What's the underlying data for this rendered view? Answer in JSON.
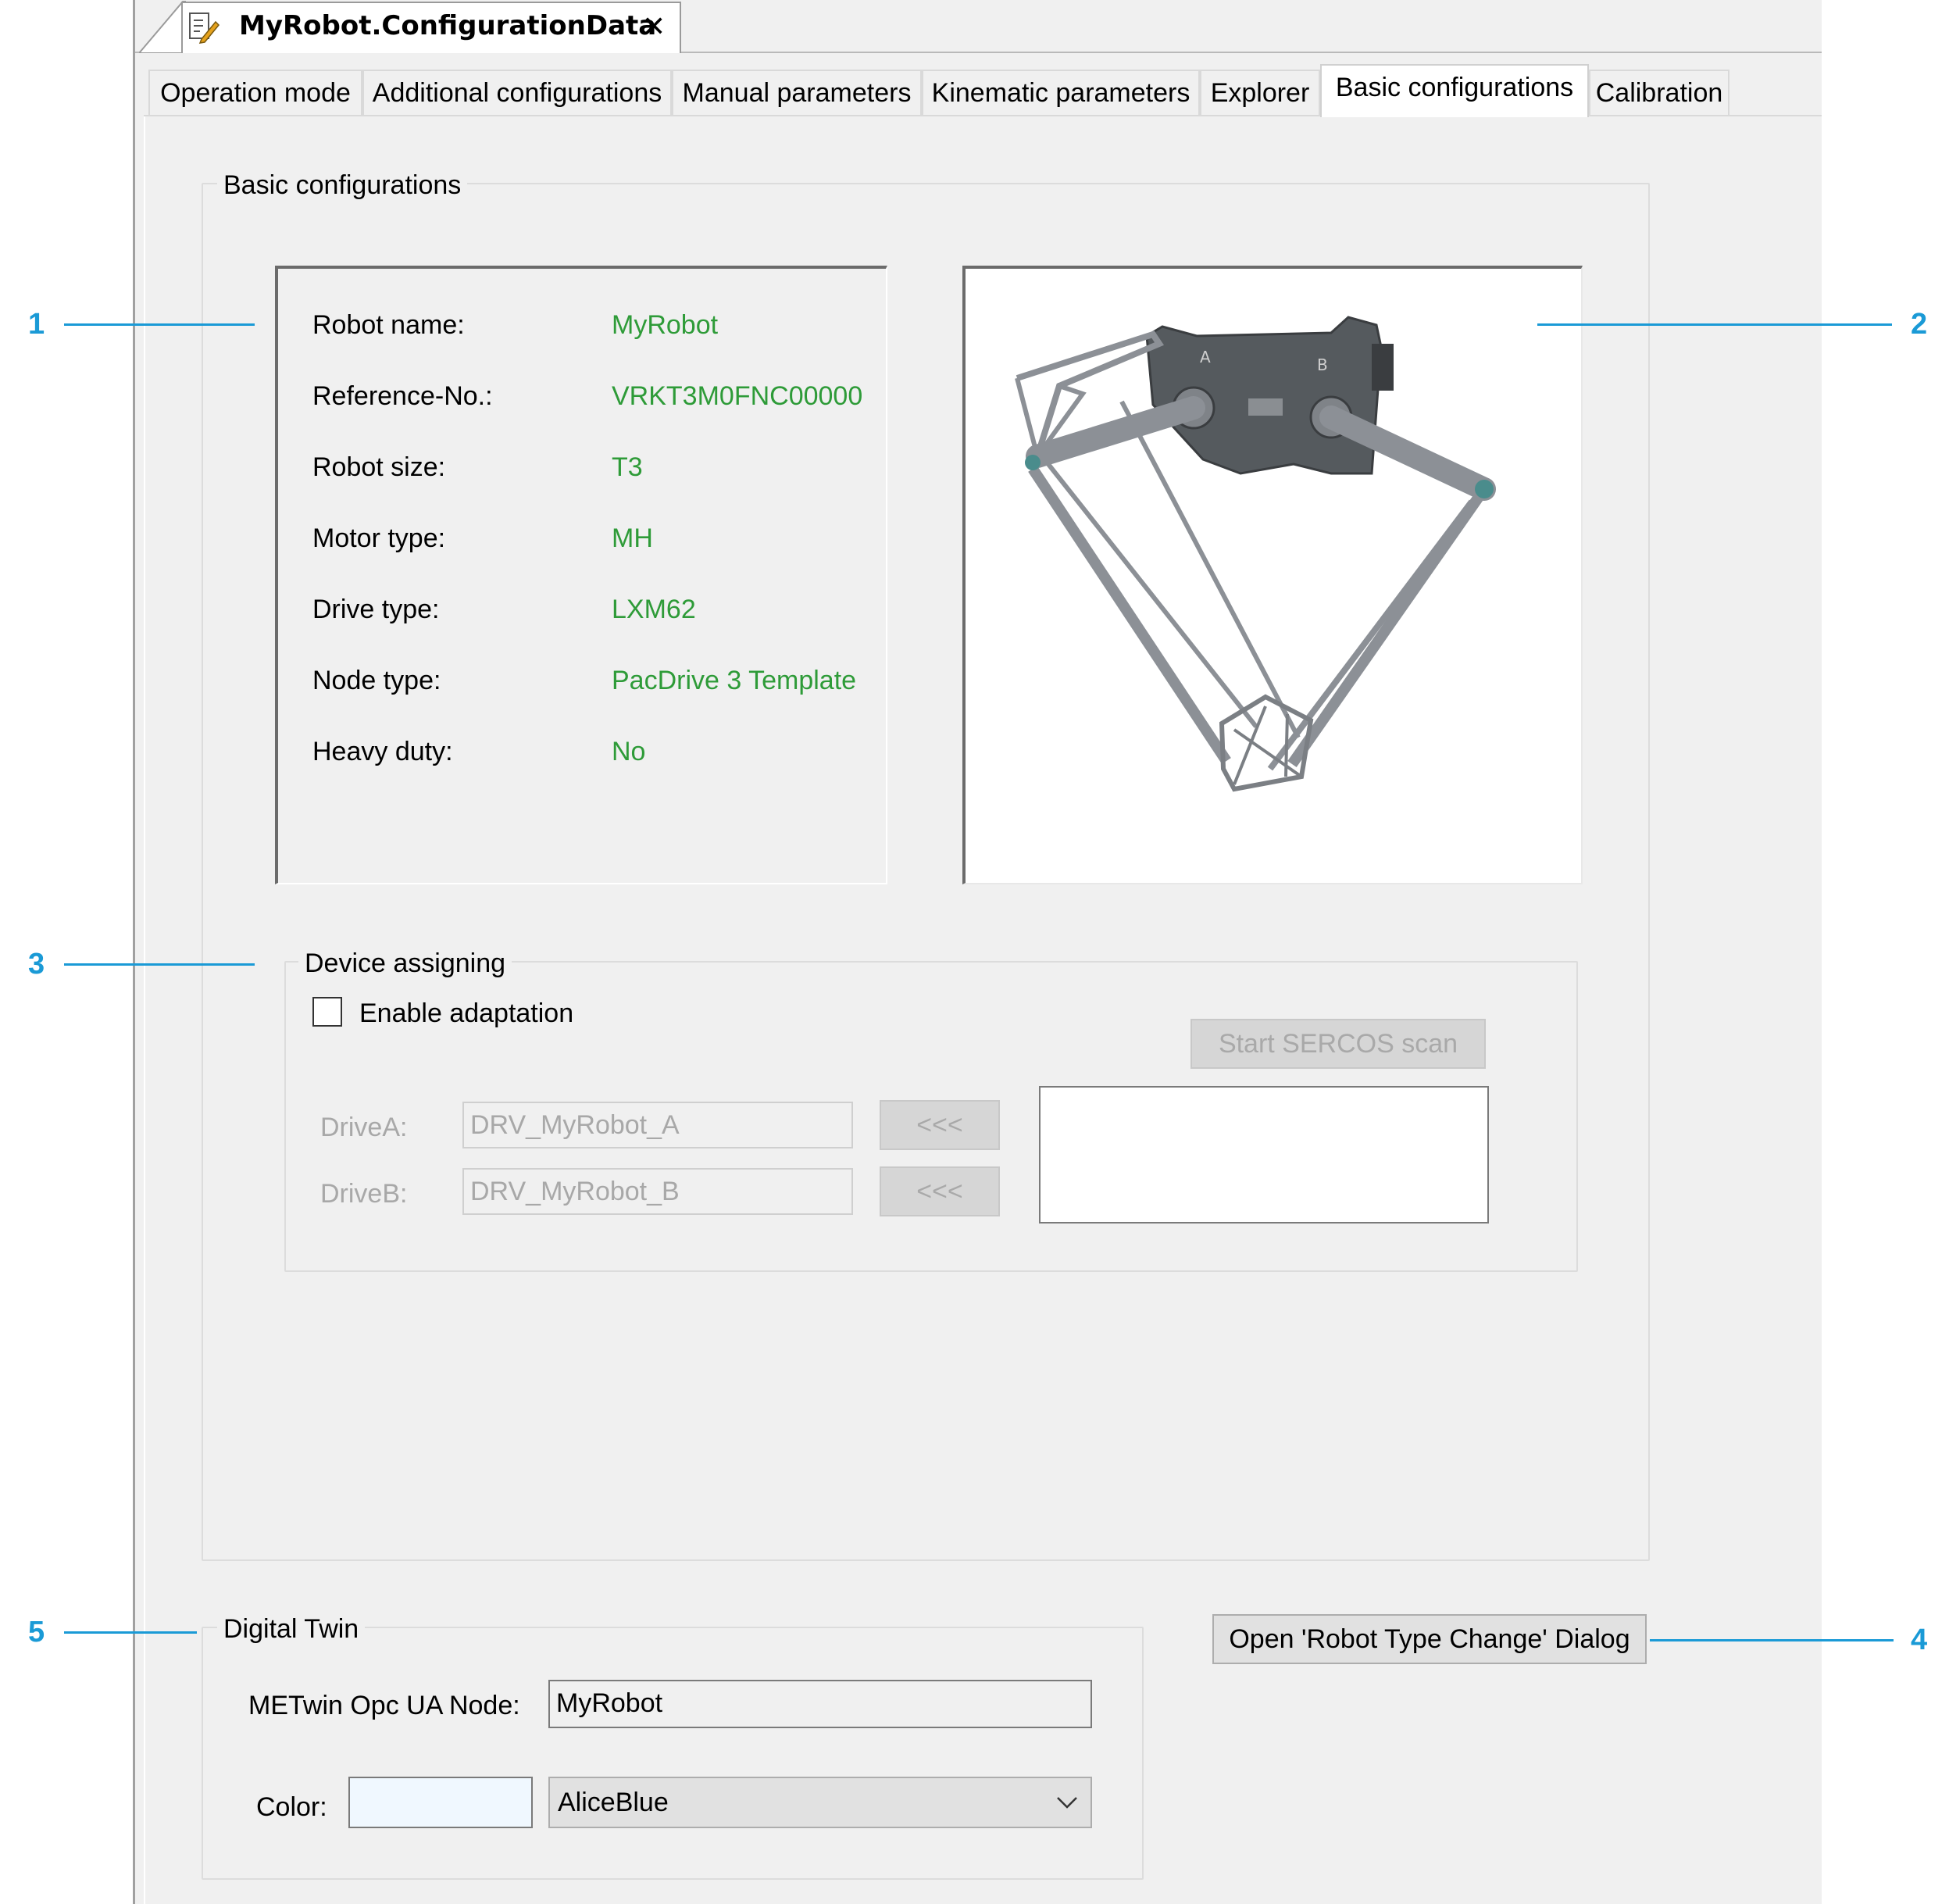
{
  "document_tab": {
    "title": "MyRobot.ConfigurationData",
    "close_glyph": "✕",
    "icon": "config-document-icon"
  },
  "tabs": [
    {
      "label": "Operation mode",
      "active": false
    },
    {
      "label": "Additional configurations",
      "active": false
    },
    {
      "label": "Manual parameters",
      "active": false
    },
    {
      "label": "Kinematic parameters",
      "active": false
    },
    {
      "label": "Explorer",
      "active": false
    },
    {
      "label": "Basic configurations",
      "active": true
    },
    {
      "label": "Calibration",
      "active": false
    }
  ],
  "basic_configurations": {
    "group_title": "Basic configurations",
    "info": [
      {
        "label": "Robot name:",
        "value": "MyRobot"
      },
      {
        "label": "Reference-No.:",
        "value": "VRKT3M0FNC00000"
      },
      {
        "label": "Robot size:",
        "value": "T3"
      },
      {
        "label": "Motor type:",
        "value": "MH"
      },
      {
        "label": "Drive type:",
        "value": "LXM62"
      },
      {
        "label": "Node type:",
        "value": "PacDrive 3 Template"
      },
      {
        "label": "Heavy duty:",
        "value": "No"
      }
    ],
    "robot_image": {
      "icon": "delta-robot-image",
      "plate_labels": [
        "A",
        "B"
      ]
    }
  },
  "device_assigning": {
    "group_title": "Device assigning",
    "enable_adaptation_label": "Enable adaptation",
    "enable_adaptation_checked": false,
    "scan_button": "Start SERCOS scan",
    "drives": [
      {
        "label": "DriveA:",
        "value": "DRV_MyRobot_A",
        "assign_button": "<<<"
      },
      {
        "label": "DriveB:",
        "value": "DRV_MyRobot_B",
        "assign_button": "<<<"
      }
    ]
  },
  "digital_twin": {
    "group_title": "Digital Twin",
    "node_label": "METwin Opc UA Node:",
    "node_value": "MyRobot",
    "color_label": "Color:",
    "color_value": "AliceBlue",
    "color_swatch": "#f0f8ff"
  },
  "robot_type_change_button": "Open 'Robot Type Change' Dialog",
  "callouts": [
    "1",
    "2",
    "3",
    "4",
    "5"
  ],
  "colors": {
    "value_text": "#2e9b38",
    "callout": "#1a9ad6",
    "panel_bg": "#f0f0f0"
  }
}
